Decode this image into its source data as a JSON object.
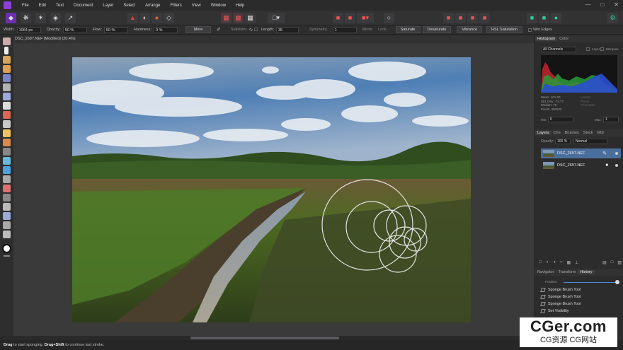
{
  "menu": [
    "File",
    "Edit",
    "Text",
    "Document",
    "Layer",
    "Select",
    "Arrange",
    "Filters",
    "View",
    "Window",
    "Help"
  ],
  "context_toolbar": {
    "width_label": "Width:",
    "width_value": "1064 px",
    "opacity_label": "Opacity:",
    "opacity_value": "50 %",
    "flow_label": "Flow:",
    "flow_value": "50 %",
    "hardness_label": "Hardness:",
    "hardness_value": "0 %",
    "more_label": "More",
    "stabilizer_label": "Stabilizer",
    "length_label": "Length:",
    "length_value": "35",
    "symmetry_label": "Symmetry",
    "symmetry_value": "1",
    "mirror_label": "Mirror",
    "lock_label": "Lock",
    "saturate_label": "Saturate",
    "desaturate_label": "Desaturate",
    "vibrance_label": "Vibrance",
    "hsl_label": "HSL Saturation",
    "wet_edges_label": "Wet Edges"
  },
  "document_tab": "DSC_2697.NEF [Modified] (20.4%)",
  "histogram_panel": {
    "tabs": [
      "Histogram",
      "Color"
    ],
    "channel": "All Channels",
    "layer_opt": "Layer",
    "marquee_opt": "Marquee",
    "stats": [
      "Mean: 101.00",
      "Std. Dev.: 73.77",
      "Median: 76",
      "Pixels: 380520"
    ],
    "stats_right": [
      "Levels:",
      "Pixels:",
      "Percentile:"
    ],
    "min_label": "Min:",
    "min_value": "0",
    "max_label": "Max:",
    "max_value": "1"
  },
  "layers_panel": {
    "tabs": [
      "Layers",
      "Chn",
      "Brushes",
      "Stock",
      "Mtd"
    ],
    "opacity_label": "Opacity:",
    "opacity_value": "100 %",
    "blend_mode": "Normal",
    "layers": [
      "DSC_2697.NEF",
      "DSC_2697.NEF"
    ]
  },
  "history_panel": {
    "tabs": [
      "Navigator",
      "Transform",
      "History"
    ],
    "position_label": "Position:",
    "items": [
      "Sponge Brush Tool",
      "Sponge Brush Tool",
      "Sponge Brush Tool",
      "Set Visibility"
    ]
  },
  "status": {
    "bold1": "Drag",
    "text1": " to start sponging. ",
    "bold2": "Drag+Shift",
    "text2": " to continue last stroke."
  },
  "watermark": {
    "brand": "CGer.com",
    "sub": "CG资源 CG网站"
  },
  "colors": {
    "accent": "#8e3fd6",
    "selected_layer": "#4a6f9c",
    "sky": "#5b84b8"
  }
}
